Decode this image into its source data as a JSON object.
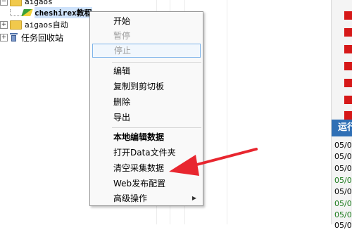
{
  "tree": {
    "root_label": "aigaos",
    "task_label": "cheshirex教程",
    "group2_label": "aigaos自动",
    "recycle_label": "任务回收站"
  },
  "context_menu": {
    "items": {
      "start": "开始",
      "pause": "暂停",
      "stop": "停止",
      "edit": "编辑",
      "copy": "复制到剪切板",
      "delete": "删除",
      "export": "导出",
      "local_edit": "本地编辑数据",
      "open_data_folder": "打开Data文件夹",
      "clear_data": "清空采集数据",
      "web_publish": "Web发布配置",
      "advanced": "高级操作"
    }
  },
  "right_panel": {
    "run_label": "运行",
    "log_entries": [
      "05/0",
      "05/0",
      "05/0",
      "05/0",
      "05/0",
      "05/0",
      "05/0",
      "05/0"
    ]
  },
  "colors": {
    "annotation_arrow": "#e8262f",
    "status_red": "#d61818",
    "header_blue": "#2f6fb5",
    "log_green": "#1a7a1a"
  },
  "icons": {
    "submenu": "triangle-right-icon",
    "folder": "folder-icon",
    "recycle": "trash-icon",
    "task": "task-icon"
  }
}
